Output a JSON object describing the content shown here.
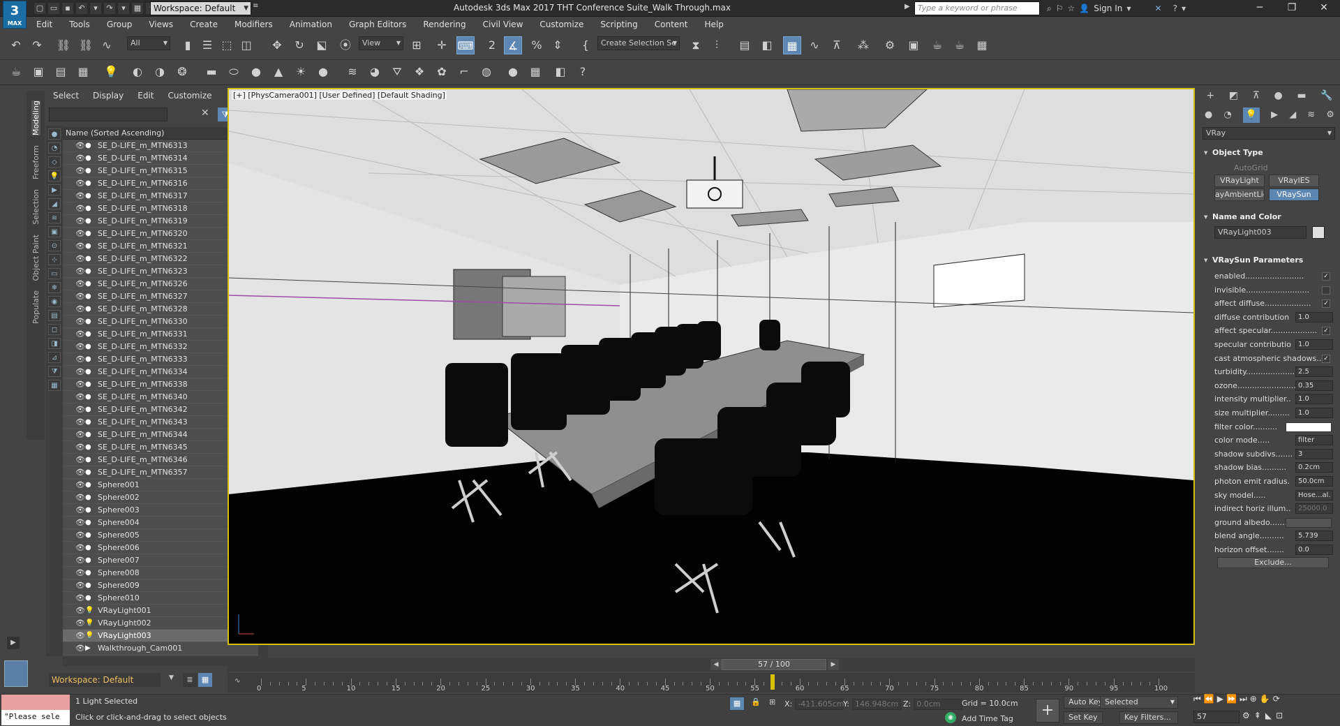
{
  "app": {
    "logo_text": "3",
    "logo_sub": "MAX",
    "workspace_top": "Workspace: Default",
    "window_title": "Autodesk 3ds Max 2017    THT Conference Suite_Walk Through.max",
    "search_placeholder": "Type a keyword or phrase",
    "sign_in": "Sign In"
  },
  "menu": [
    "Edit",
    "Tools",
    "Group",
    "Views",
    "Create",
    "Modifiers",
    "Animation",
    "Graph Editors",
    "Rendering",
    "Civil View",
    "Customize",
    "Scripting",
    "Content",
    "Help"
  ],
  "toolbar": {
    "filter_all": "All",
    "ref_coord": "View",
    "selection_set": "Create Selection Se"
  },
  "ribbon_tabs": [
    "Modeling",
    "Freeform",
    "Selection",
    "Object Paint",
    "Populate"
  ],
  "explorer": {
    "tabs": [
      "Select",
      "Display",
      "Edit",
      "Customize"
    ],
    "header": "Name (Sorted Ascending)",
    "items": [
      "SE_D-LIFE_m_MTN6313",
      "SE_D-LIFE_m_MTN6314",
      "SE_D-LIFE_m_MTN6315",
      "SE_D-LIFE_m_MTN6316",
      "SE_D-LIFE_m_MTN6317",
      "SE_D-LIFE_m_MTN6318",
      "SE_D-LIFE_m_MTN6319",
      "SE_D-LIFE_m_MTN6320",
      "SE_D-LIFE_m_MTN6321",
      "SE_D-LIFE_m_MTN6322",
      "SE_D-LIFE_m_MTN6323",
      "SE_D-LIFE_m_MTN6326",
      "SE_D-LIFE_m_MTN6327",
      "SE_D-LIFE_m_MTN6328",
      "SE_D-LIFE_m_MTN6330",
      "SE_D-LIFE_m_MTN6331",
      "SE_D-LIFE_m_MTN6332",
      "SE_D-LIFE_m_MTN6333",
      "SE_D-LIFE_m_MTN6334",
      "SE_D-LIFE_m_MTN6338",
      "SE_D-LIFE_m_MTN6340",
      "SE_D-LIFE_m_MTN6342",
      "SE_D-LIFE_m_MTN6343",
      "SE_D-LIFE_m_MTN6344",
      "SE_D-LIFE_m_MTN6345",
      "SE_D-LIFE_m_MTN6346",
      "SE_D-LIFE_m_MTN6357",
      "Sphere001",
      "Sphere002",
      "Sphere003",
      "Sphere004",
      "Sphere005",
      "Sphere006",
      "Sphere007",
      "Sphere008",
      "Sphere009",
      "Sphere010",
      "VRayLight001",
      "VRayLight002",
      "VRayLight003",
      "Walkthrough_Cam001"
    ],
    "selected": "VRayLight003",
    "workspace": "Workspace: Default"
  },
  "viewport": {
    "label": "[+] [PhysCamera001] [User Defined] [Default Shading]"
  },
  "timeline": {
    "frame": "57 / 100",
    "current": 57,
    "end": 100,
    "ticks": [
      "0",
      "5",
      "10",
      "15",
      "20",
      "25",
      "30",
      "35",
      "40",
      "45",
      "50",
      "55",
      "60",
      "65",
      "70",
      "75",
      "80",
      "85",
      "90",
      "95",
      "100"
    ]
  },
  "status": {
    "listener": "\"Please sele",
    "selected": "1 Light Selected",
    "prompt": "Click or click-and-drag to select objects",
    "x_label": "X:",
    "x_value": "-411.605cm",
    "y_label": "Y:",
    "y_value": "146.948cm",
    "z_label": "Z:",
    "z_value": "0.0cm",
    "grid": "Grid = 10.0cm",
    "add_time_tag": "Add Time Tag",
    "auto_key": "Auto Key",
    "set_key": "Set Key",
    "key_mode": "Selected",
    "key_filters": "Key Filters...",
    "frame_field": "57"
  },
  "cmd": {
    "category": "VRay",
    "object_type": "Object Type",
    "autogrid": "AutoGrid",
    "buttons": [
      "VRayLight",
      "VRayIES",
      "ayAmbientLig",
      "VRaySun"
    ],
    "name_and_color": "Name and Color",
    "object_name": "VRayLight003",
    "params_title": "VRaySun Parameters",
    "params": [
      {
        "label": "enabled........................",
        "kind": "check",
        "value": "✓"
      },
      {
        "label": "invisible..........................",
        "kind": "check",
        "value": ""
      },
      {
        "label": "affect diffuse...................",
        "kind": "check",
        "value": "✓"
      },
      {
        "label": "diffuse contribution",
        "kind": "num",
        "value": "1.0"
      },
      {
        "label": "affect specular...................",
        "kind": "check",
        "value": "✓"
      },
      {
        "label": "specular contributio",
        "kind": "num",
        "value": "1.0"
      },
      {
        "label": "cast atmospheric shadows..",
        "kind": "check",
        "value": "✓"
      },
      {
        "label": "turbidity...........................",
        "kind": "num",
        "value": "2.5"
      },
      {
        "label": "ozone...............................",
        "kind": "num",
        "value": "0.35"
      },
      {
        "label": "intensity multiplier..",
        "kind": "num",
        "value": "1.0"
      },
      {
        "label": "size multiplier.........",
        "kind": "num",
        "value": "1.0"
      },
      {
        "label": "filter color..........",
        "kind": "swatch",
        "value": ""
      },
      {
        "label": "color mode.....",
        "kind": "num",
        "value": "filter"
      },
      {
        "label": "shadow subdivs.......",
        "kind": "num",
        "value": "3"
      },
      {
        "label": "shadow bias..........",
        "kind": "num",
        "value": "0.2cm"
      },
      {
        "label": "photon emit radius.",
        "kind": "num",
        "value": "50.0cm"
      },
      {
        "label": "sky model.....",
        "kind": "num",
        "value": "Hose...al."
      },
      {
        "label": "indirect horiz illum..",
        "kind": "numdis",
        "value": "25000.0"
      },
      {
        "label": "ground albedo.......",
        "kind": "swatchgrey",
        "value": ""
      },
      {
        "label": "blend angle..........",
        "kind": "num",
        "value": "5.739"
      },
      {
        "label": "horizon offset.......",
        "kind": "num",
        "value": "0.0"
      }
    ],
    "exclude": "Exclude..."
  }
}
